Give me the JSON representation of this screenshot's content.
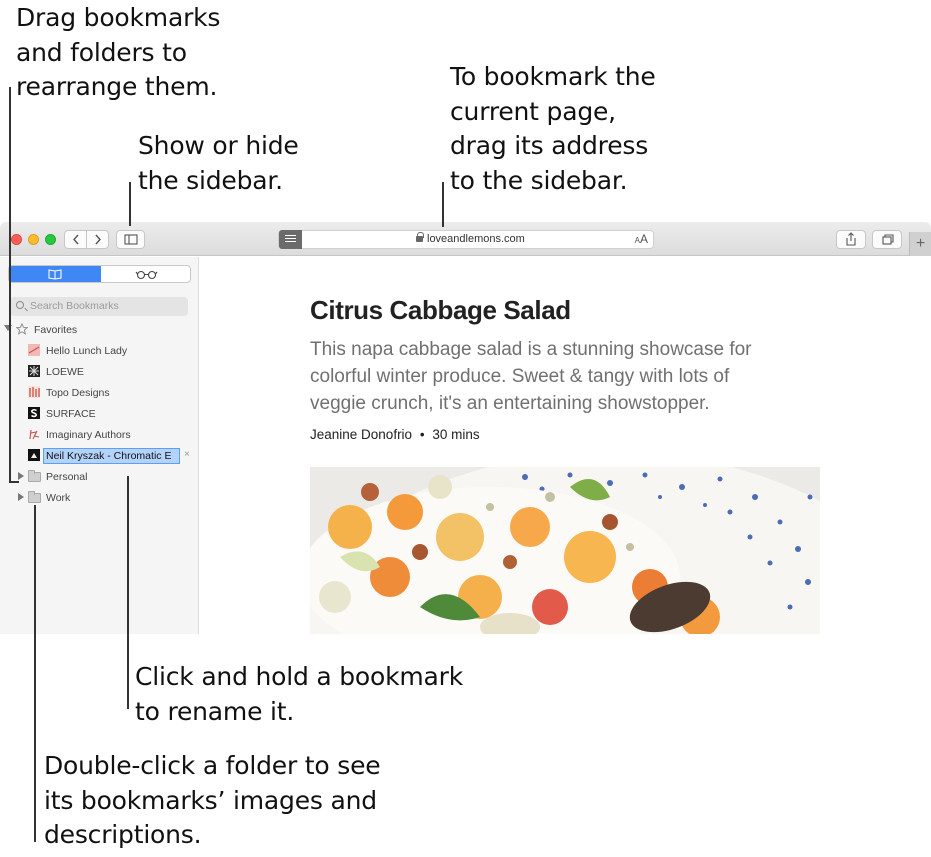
{
  "callouts": {
    "drag": [
      "Drag bookmarks",
      "and folders to",
      "rearrange them."
    ],
    "sidebar_toggle": [
      "Show or hide",
      "the sidebar."
    ],
    "bookmark_page": [
      "To bookmark the",
      "current page,",
      "drag its address",
      "to the sidebar."
    ],
    "rename": [
      "Click and hold a bookmark",
      "to rename it."
    ],
    "double_click": [
      "Double-click a folder to see",
      "its bookmarks’ images and",
      "descriptions."
    ]
  },
  "toolbar": {
    "back_icon": "chevron-left-icon",
    "forward_icon": "chevron-right-icon",
    "sidebar_icon": "sidebar-icon",
    "url": "loveandlemons.com",
    "text_size_small": "A",
    "text_size_large": "A",
    "share_icon": "share-icon",
    "tabs_icon": "tabs-icon",
    "new_tab": "+"
  },
  "sidebar": {
    "tab_bookmarks_icon": "book-icon",
    "tab_reading_list_icon": "glasses-icon",
    "search_placeholder": "Search Bookmarks",
    "favorites_label": "Favorites",
    "bookmarks": [
      {
        "label": "Hello Lunch Lady",
        "icon": "hello-lunch-lady-icon"
      },
      {
        "label": "LOEWE",
        "icon": "loewe-icon"
      },
      {
        "label": "Topo Designs",
        "icon": "topo-designs-icon"
      },
      {
        "label": "SURFACE",
        "icon": "surface-icon"
      },
      {
        "label": "Imaginary Authors",
        "icon": "imaginary-authors-icon"
      },
      {
        "label": "Neil Kryszak - Chromatic E",
        "icon": "neil-kryszak-icon"
      }
    ],
    "folders": [
      "Personal",
      "Work"
    ]
  },
  "article": {
    "title": "Citrus Cabbage Salad",
    "dek": [
      "This napa cabbage salad is a stunning showcase for",
      "colorful winter produce. Sweet & tangy with lots of",
      "veggie crunch, it's an entertaining showstopper."
    ],
    "author": "Jeanine Donofrio",
    "separator": "•",
    "time": "30 mins"
  },
  "colors": {
    "accent": "#3f87f5",
    "selection": "#b4d3fb",
    "close": "#fc5f57",
    "minimize": "#fdbc2e",
    "zoom": "#27c840"
  }
}
